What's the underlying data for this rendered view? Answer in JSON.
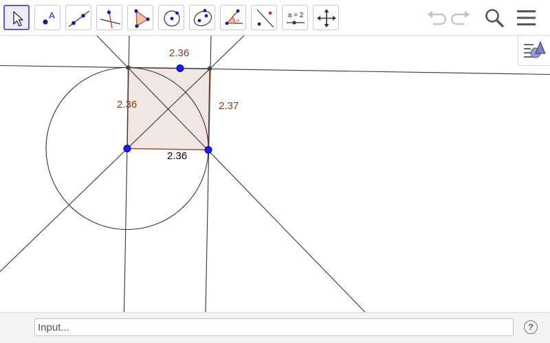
{
  "toolbar": {
    "tools": [
      {
        "name": "move-tool",
        "icon": "arrow-cursor-icon",
        "selected": true
      },
      {
        "name": "point-tool",
        "icon": "point-icon",
        "glyph": "A"
      },
      {
        "name": "line-tool",
        "icon": "line-through-points-icon"
      },
      {
        "name": "perpendicular-line-tool",
        "icon": "perpendicular-line-icon"
      },
      {
        "name": "polygon-tool",
        "icon": "polygon-icon"
      },
      {
        "name": "circle-tool",
        "icon": "circle-center-point-icon"
      },
      {
        "name": "conic-tool",
        "icon": "ellipse-icon"
      },
      {
        "name": "angle-tool",
        "icon": "angle-icon"
      },
      {
        "name": "reflect-tool",
        "icon": "reflect-about-line-icon"
      },
      {
        "name": "slider-tool",
        "icon": "slider-icon",
        "glyph": "a = 2"
      },
      {
        "name": "move-graphics-view-tool",
        "icon": "move-view-arrows-icon"
      }
    ],
    "undo_icon": "undo-icon",
    "redo_icon": "redo-icon",
    "search_icon": "search-icon",
    "menu_icon": "hamburger-menu-icon"
  },
  "canvas": {
    "style_bar_icon": "graphics-style-bar-icon",
    "labels": {
      "top_side": "2.36",
      "left_side": "2.36",
      "right_side": "2.37",
      "bottom_side": "2.36"
    },
    "colors": {
      "label_brown": "#8b3a1a",
      "polygon_fill": "#f2e6e2",
      "polygon_stroke": "#a0522d",
      "free_point": "#1a1aff",
      "line": "#333333"
    }
  },
  "input_bar": {
    "placeholder": "Input...",
    "help_label": "?"
  }
}
